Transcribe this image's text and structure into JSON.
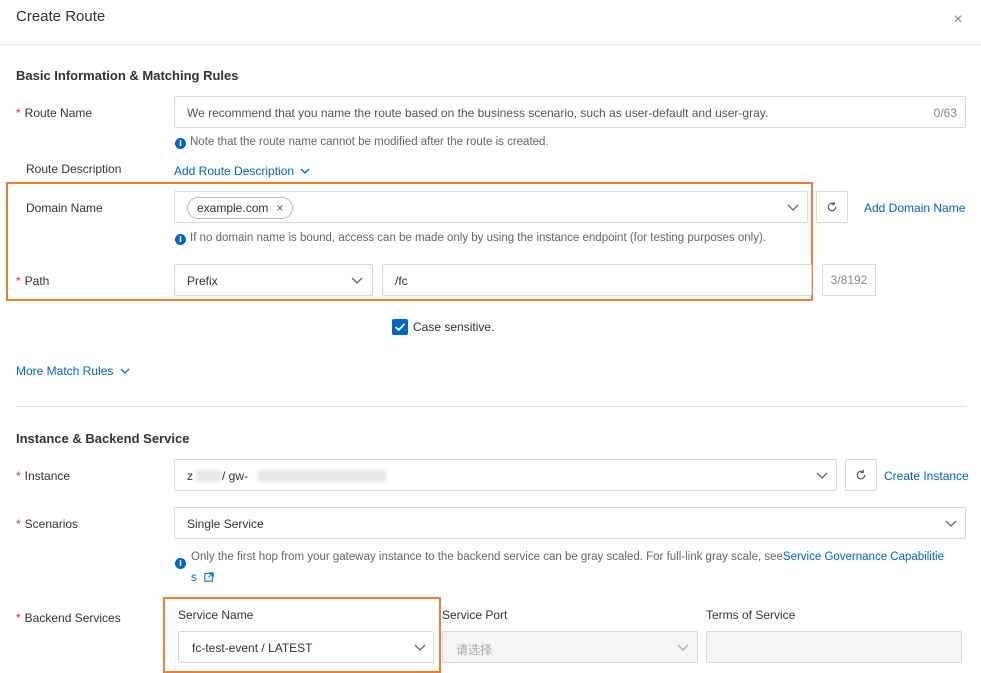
{
  "dialog": {
    "title": "Create Route",
    "close_icon": "×"
  },
  "basic": {
    "section_title": "Basic Information & Matching Rules",
    "route_name": {
      "label": "Route Name",
      "required_mark": "*",
      "placeholder": "We recommend that you name the route based on the business scenario, such as user-default and user-gray.",
      "counter": "0/63",
      "note": "Note that the route name cannot be modified after the route is created."
    },
    "route_description": {
      "label": "Route Description",
      "link": "Add Route Description"
    },
    "domain_name": {
      "label": "Domain Name",
      "tag": "example.com",
      "tag_remove": "×",
      "add_link": "Add Domain Name",
      "note": "If no domain name is bound, access can be made only by using the instance endpoint (for testing purposes only)."
    },
    "path": {
      "label": "Path",
      "required_mark": "*",
      "match_type": "Prefix",
      "value": "/fc",
      "counter": "3/8192"
    },
    "case_sensitive": {
      "label": "Case sensitive.",
      "checked": true
    },
    "more_match_rules": "More Match Rules"
  },
  "instance_backend": {
    "section_title": "Instance & Backend Service",
    "instance": {
      "label": "Instance",
      "required_mark": "*",
      "value_prefix": "z",
      "value_mid": " / gw-",
      "create_link": "Create Instance"
    },
    "scenarios": {
      "label": "Scenarios",
      "required_mark": "*",
      "value": "Single Service",
      "note": "Only the first hop from your gateway instance to the backend service can be gray scaled. For full-link gray scale, see",
      "note_link_line1": "Service Governance Capabilitie",
      "note_link_line2": "s"
    },
    "backend_services": {
      "label": "Backend Services",
      "required_mark": "*",
      "columns": [
        "Service Name",
        "Service Port",
        "Terms of Service"
      ],
      "service_name_value": "fc-test-event / LATEST",
      "service_port_placeholder": "请选择"
    }
  },
  "colors": {
    "accent": "#0064c8",
    "highlight": "#ed7d31",
    "required": "#d93026"
  }
}
